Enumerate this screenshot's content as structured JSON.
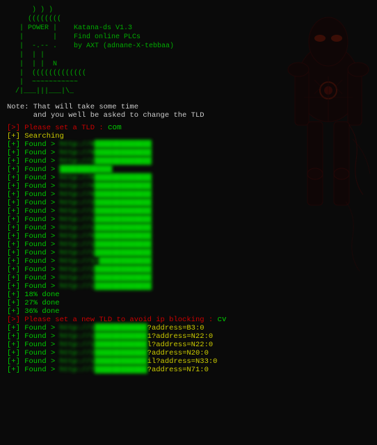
{
  "terminal": {
    "title": "Katana-ds V1.3",
    "ascii_art": "      ) ) )\n     ((((((((\n   | POWER |    Katana-ds V1.3\n   |       |    Find online PLCs\n   |  -.-- .    by AXT (adnane-X-tebbaa)\n   |  | |\n   |  | |  N\n   |  (((((((((((((\n   |  ~~~~~~~~~~~\n  /|___|||___|\\_",
    "note": "Note: That will take some time\n      and you well be asked to change the TLD",
    "prompt1": "[>] Please set a TLD : ",
    "prompt1_value": "com",
    "searching": "[+] Searching",
    "found_lines": [
      "[+] Found > http://8█████████████████",
      "[+] Found > http://9█████████████████",
      "[+] Found > http://2█████████████████",
      "[+] Found > ████████████████",
      "[+] Found > http://b█████████████████",
      "[+] Found > http://6█████████████████",
      "[+] Found > http://6█████████████████",
      "[+] Found > http://2█████████████████",
      "[+] Found > http://2█████████████████",
      "[+] Found > http://1█████████████████",
      "[+] Found > http://1█████████████████",
      "[+] Found > http://5█████████████████",
      "[+] Found > http://1█████████████████",
      "[+] Found > http://1█████████████████",
      "[+] Found > http://1n████████████████",
      "[+] Found > http://2█████████████████",
      "[+] Found > http://1█████████████████",
      "[+] Found > http://1█████████████████"
    ],
    "done_lines": [
      "[+] 18% done",
      "[+] 27% done",
      "[+] 36% done"
    ],
    "prompt2": "[>] Please set a new TLD to avoid ip blocking : ",
    "prompt2_value": "cv",
    "found_param_lines": [
      {
        "prefix": "[+] Found > http://1██████████████",
        "param": "?address=B3:0"
      },
      {
        "prefix": "[+] Found > http://1████████████",
        "param": "1?address=N22:0"
      },
      {
        "prefix": "[+] Found > http://1████████████",
        "param": "l?address=N22:0"
      },
      {
        "prefix": "[+] Found > http://2████████████",
        "param": "?address=N20:0"
      },
      {
        "prefix": "[+] Found > http://1█████████████",
        "param": "il?address=N33:0"
      },
      {
        "prefix": "[+] Found > http://7█████████████",
        "param": "?address=N71:0"
      }
    ]
  }
}
